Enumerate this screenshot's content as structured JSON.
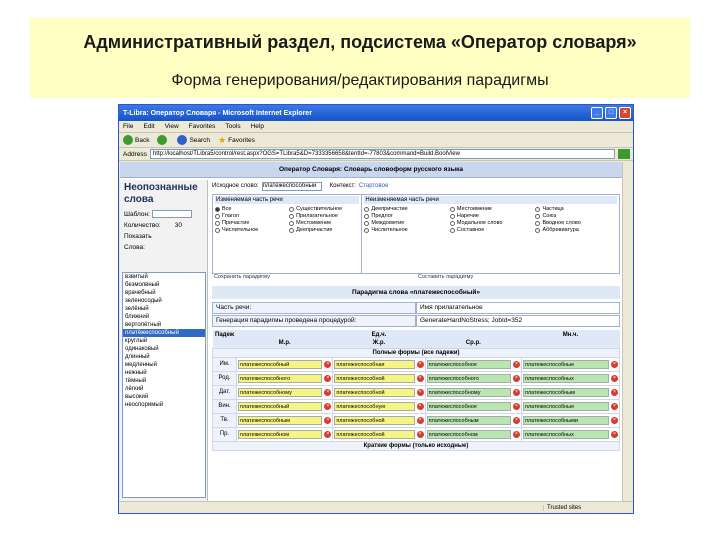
{
  "slide": {
    "title": "Административный раздел,  подсистема «Оператор словаря»",
    "subtitle": "Форма генерирования/редактирования парадигмы"
  },
  "browser": {
    "window_title": "T-Libra: Оператор Словаря - Microsoft Internet Explorer",
    "menu": [
      "File",
      "Edit",
      "View",
      "Favorites",
      "Tools",
      "Help"
    ],
    "toolbar": {
      "back": "Back",
      "search": "Search",
      "favorites": "Favorites"
    },
    "address_label": "Address",
    "address": "http://localhost/TLibra5/control/rest.aspx?OGS=TLibra5&D=7333356658&tentId=-77803&command=Build.BoolView",
    "go_label": "Go",
    "status_text": "",
    "status_zone": "Trusted sites"
  },
  "page": {
    "header": "Оператор Словаря: Словарь словоформ русского языка",
    "left": {
      "heading": "Неопознанные слова",
      "pattern_label": "Шаблон:",
      "count_label": "Количество:",
      "count_value": "30",
      "show_label": "Показать",
      "words_label": "Слова:",
      "words": [
        "взвитый",
        "безмолвный",
        "врачебный",
        "зеленосодый",
        "зелёный",
        "ближний",
        "вертолётный",
        "платёжеспособный",
        "круглый",
        "одинаковый",
        "длинный",
        "медленный",
        "нежный",
        "тёмный",
        "лёгкий",
        "высокий",
        "неоспоримый"
      ],
      "selected_index": 7
    },
    "search": {
      "word_label": "Исходное слово:",
      "word_value": "платежеспособный",
      "context_label": "Контекст:",
      "context_value": "Стартовое"
    },
    "pos": {
      "changeable_label": "Изменяемая часть речи",
      "changeable": [
        "Все",
        "Существительное",
        "Глагол",
        "Прилагательное",
        "Причастие",
        "Местоимение",
        "Числительное",
        "Деепричастие"
      ],
      "changeable_selected": 0,
      "unchangeable_label": "Неизменяемая часть речи",
      "unchangeable": [
        "Деепричастие",
        "Местоимение",
        "Частица",
        "Предлог",
        "Наречие",
        "Союз",
        "Междометие",
        "Модальное слово",
        "Вводное слово",
        "Числительное",
        "Составное",
        "Аббревиатура"
      ],
      "save_label": "Сохранить парадигму",
      "start_label": "Составить парадигму"
    },
    "paradigm": {
      "title": "Парадигма слова «платежеспособный»",
      "pos_label": "Часть речи:",
      "pos_value": "Имя прилагательное",
      "generation_label": "Генерация парадигмы проведена процедурой:",
      "generation_value": "GenerateHardNoStress; JobId=352",
      "col_case": "Падеж",
      "col_singular": "Ед.ч.",
      "col_m": "М.р.",
      "col_f": "Ж.р.",
      "col_n": "Ср.р.",
      "col_plural": "Мн.ч.",
      "full_forms_label": "Полные формы (все падежи)",
      "short_forms_label": "Краткие формы (только исходные)",
      "rows": [
        {
          "case": "Им.",
          "forms": [
            "платежеспособный",
            "платежеспособная",
            "платежеспособное",
            "платежеспособные"
          ]
        },
        {
          "case": "Род.",
          "forms": [
            "платежеспособного",
            "платежеспособной",
            "платежеспособного",
            "платежеспособных"
          ]
        },
        {
          "case": "Дат.",
          "forms": [
            "платежеспособному",
            "платежеспособной",
            "платежеспособному",
            "платежеспособным"
          ]
        },
        {
          "case": "Вин.",
          "forms": [
            "платежеспособный",
            "платежеспособную",
            "платежеспособное",
            "платежеспособные"
          ]
        },
        {
          "case": "Тв.",
          "forms": [
            "платежеспособным",
            "платежеспособной",
            "платежеспособным",
            "платежеспособными"
          ]
        },
        {
          "case": "Пр.",
          "forms": [
            "платежеспособном",
            "платежеспособной",
            "платежеспособном",
            "платежеспособных"
          ]
        }
      ]
    }
  },
  "colors": {
    "slide_header_bg": "#ffffc4",
    "form_yellow": "#f5f585",
    "form_green": "#b9e6b0",
    "delete_red": "#d83a2e",
    "selection": "#316ac5"
  }
}
